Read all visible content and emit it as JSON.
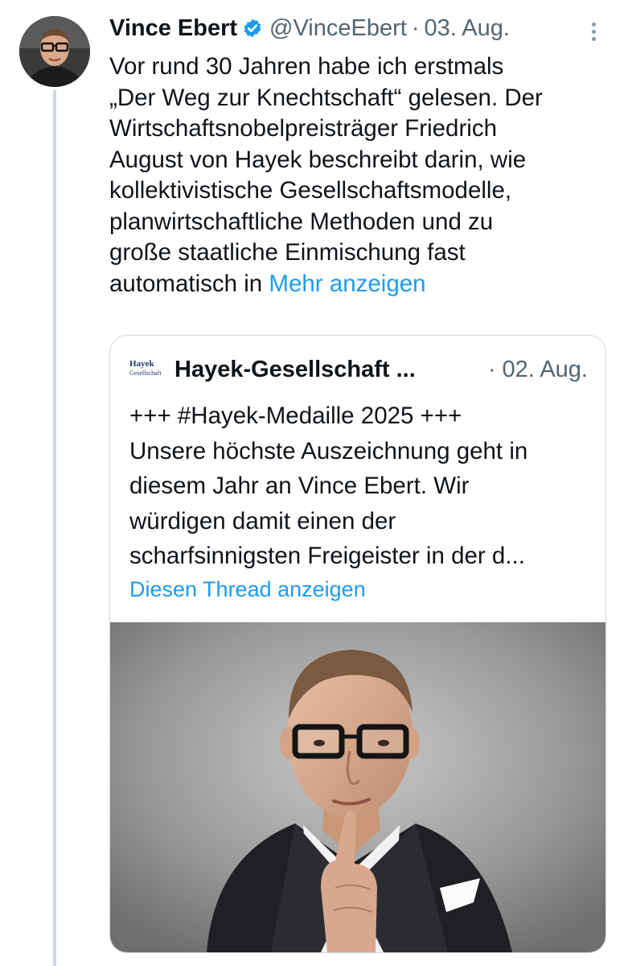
{
  "tweet": {
    "author_name": "Vince Ebert",
    "handle": "@VinceEbert",
    "separator": "·",
    "date": "03. Aug.",
    "text_lines": [
      "Vor rund 30 Jahren habe ich erstmals",
      "„Der Weg zur Knechtschaft“ gelesen. Der",
      "Wirtschaftsnobelpreisträger Friedrich",
      "August von Hayek beschreibt darin, wie",
      "kollektivistische Gesellschaftsmodelle,",
      "planwirtschaftliche Methoden und zu",
      "große staatliche Einmischung fast"
    ],
    "last_line_text": "automatisch in",
    "show_more_label": "Mehr anzeigen",
    "avatar_icon": "author-avatar",
    "verified_icon": "verified-badge-icon",
    "more_icon": "more-options-icon"
  },
  "quote": {
    "logo_line1": "Hayek",
    "logo_line2": "Gesellschaft",
    "author_name": "Hayek-Gesellschaft",
    "ellipsis": "...",
    "date": "· 02. Aug.",
    "text_lines": [
      "+++ #Hayek-Medaille 2025 +++",
      "Unsere höchste Auszeichnung geht in",
      "diesem Jahr an Vince Ebert. Wir",
      "würdigen damit einen der",
      "scharfsinnigsten Freigeister in der d..."
    ],
    "thread_label": "Diesen Thread anzeigen",
    "media_icon": "portrait-photo"
  },
  "colors": {
    "text": "#0f1419",
    "secondary": "#536471",
    "link": "#1d9bf0",
    "border": "#cfd9de"
  }
}
